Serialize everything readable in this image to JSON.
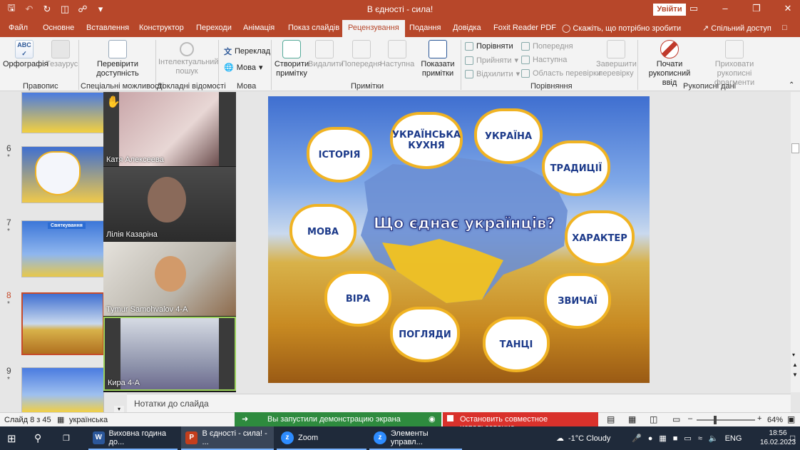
{
  "window": {
    "title": "В єдності - сила!",
    "signin": "Увійти",
    "minimize": "–",
    "restore": "❐",
    "close": "✕",
    "ribbon_display": "▭"
  },
  "tabs": [
    "Файл",
    "Основне",
    "Вставлення",
    "Конструктор",
    "Переходи",
    "Анімація",
    "Показ слайдів",
    "Рецензування",
    "Подання",
    "Довідка",
    "Foxit Reader PDF"
  ],
  "tell_me": "Скажіть, що потрібно зробити",
  "share": "Спільний доступ",
  "ribbon": {
    "spelling": "Орфографія",
    "thesaurus": "Тезаурус",
    "check_accessibility_1": "Перевірити",
    "check_accessibility_2": "доступність",
    "smart_lookup_1": "Інтелектуальний",
    "smart_lookup_2": "пошук",
    "translate": "Переклад",
    "language": "Мова",
    "new_comment_1": "Створити",
    "new_comment_2": "примітку",
    "delete": "Видалити",
    "previous": "Попередня",
    "next": "Наступна",
    "show_comments_1": "Показати",
    "show_comments_2": "примітки",
    "compare": "Порівняти",
    "accept": "Прийняти",
    "reject": "Відхилити",
    "prev_change": "Попередня",
    "next_change": "Наступна",
    "reviewing_pane": "Область перевірки",
    "end_review_1": "Завершити",
    "end_review_2": "перевірку",
    "start_inking_1": "Почати",
    "start_inking_2": "рукописний ввід",
    "hide_ink_1": "Приховати рукописні",
    "hide_ink_2": "фрагменти",
    "groups": [
      "Правопис",
      "Спеціальні можливості",
      "Докладні відомості",
      "Мова",
      "Примітки",
      "Порівняння",
      "Рукописні дані"
    ]
  },
  "slides": [
    {
      "num": "6",
      "star": "*"
    },
    {
      "num": "7",
      "star": "*",
      "caption": "Святкування"
    },
    {
      "num": "8",
      "star": "*"
    },
    {
      "num": "9",
      "star": "*"
    }
  ],
  "participants": [
    {
      "name": "Катя Алексеева",
      "hand": "✋"
    },
    {
      "name": "Лілія Казаріна"
    },
    {
      "name": "Tymur Samohvalov 4-A"
    },
    {
      "name": "Кира 4-А"
    }
  ],
  "slide": {
    "center_text": "Що єднає українців?",
    "hearts": [
      "ІСТОРІЯ",
      "УКРАЇНСЬКА КУХНЯ",
      "УКРАЇНА",
      "ТРАДИЦІЇ",
      "МОВА",
      "ХАРАКТЕР",
      "ВІРА",
      "ЗВИЧАЇ",
      "ПОГЛЯДИ",
      "ТАНЦІ"
    ]
  },
  "notes_placeholder": "Нотатки до слайда",
  "status": {
    "slide_of": "Слайд 8 з 45",
    "language": "українська",
    "share_started": "Вы запустили демонстрацию экрана",
    "stop_share": "Остановить совместное использование",
    "zoom_level": "64%"
  },
  "taskbar": {
    "word": "Виховна година до...",
    "ppt": "В єдності - сила! - ...",
    "zoom": "Zoom",
    "zoom_controls": "Элементы управл...",
    "weather": "-1°C  Cloudy",
    "lang": "ENG",
    "time": "18:56",
    "date": "16.02.2023"
  },
  "colors": {
    "accent": "#b7472a",
    "green": "#2e8b3e",
    "red": "#d9312b",
    "heart_border": "#f0b323",
    "heart_text": "#1c3a8a"
  }
}
